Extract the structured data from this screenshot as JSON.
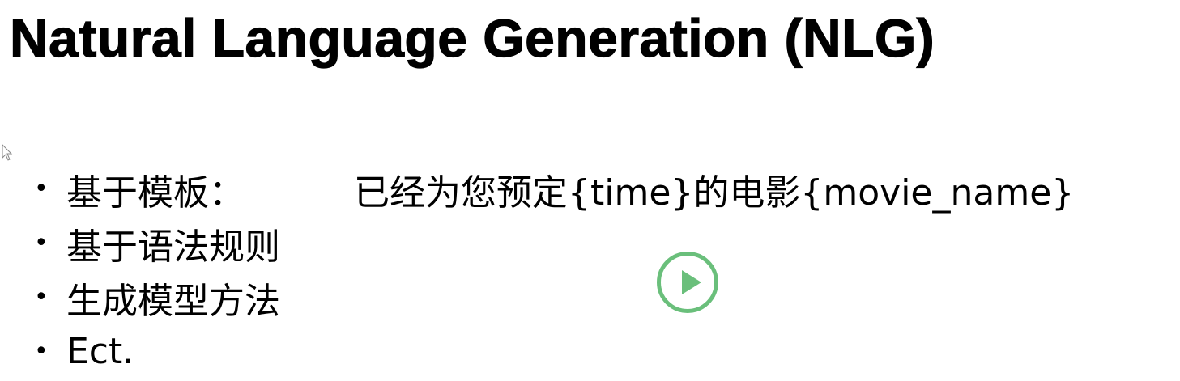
{
  "title": "Natural Language Generation (NLG)",
  "bullet_glyph": "•",
  "bullets": [
    "基于模板：",
    "基于语法规则",
    "生成模型方法",
    "Ect."
  ],
  "template_example": "已经为您预定{time}的电影{movie_name}",
  "colors": {
    "background": "#ffffff",
    "text": "#000000",
    "play_button": "#6abf7b"
  },
  "icons": {
    "play": "play-icon",
    "cursor": "mouse-pointer-icon"
  }
}
